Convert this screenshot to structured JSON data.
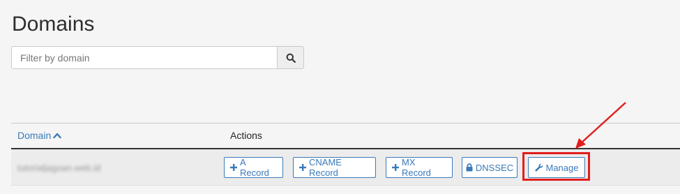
{
  "page": {
    "title": "Domains"
  },
  "search": {
    "placeholder": "Filter by domain",
    "value": ""
  },
  "table": {
    "columns": {
      "domain": "Domain",
      "actions": "Actions"
    },
    "rows": [
      {
        "domain": "tutorialjagoan.web.id",
        "actions": {
          "a_record": "A Record",
          "cname_record": "CNAME Record",
          "mx_record": "MX Record",
          "dnssec": "DNSSEC",
          "manage": "Manage"
        }
      }
    ]
  },
  "colors": {
    "link": "#3a7ab9",
    "highlight": "#e21d1d",
    "background": "#f5f5f5"
  },
  "icons": {
    "search": "search-icon",
    "sort": "chevron-up-icon",
    "add": "plus-icon",
    "lock": "lock-icon",
    "wrench": "wrench-icon"
  }
}
